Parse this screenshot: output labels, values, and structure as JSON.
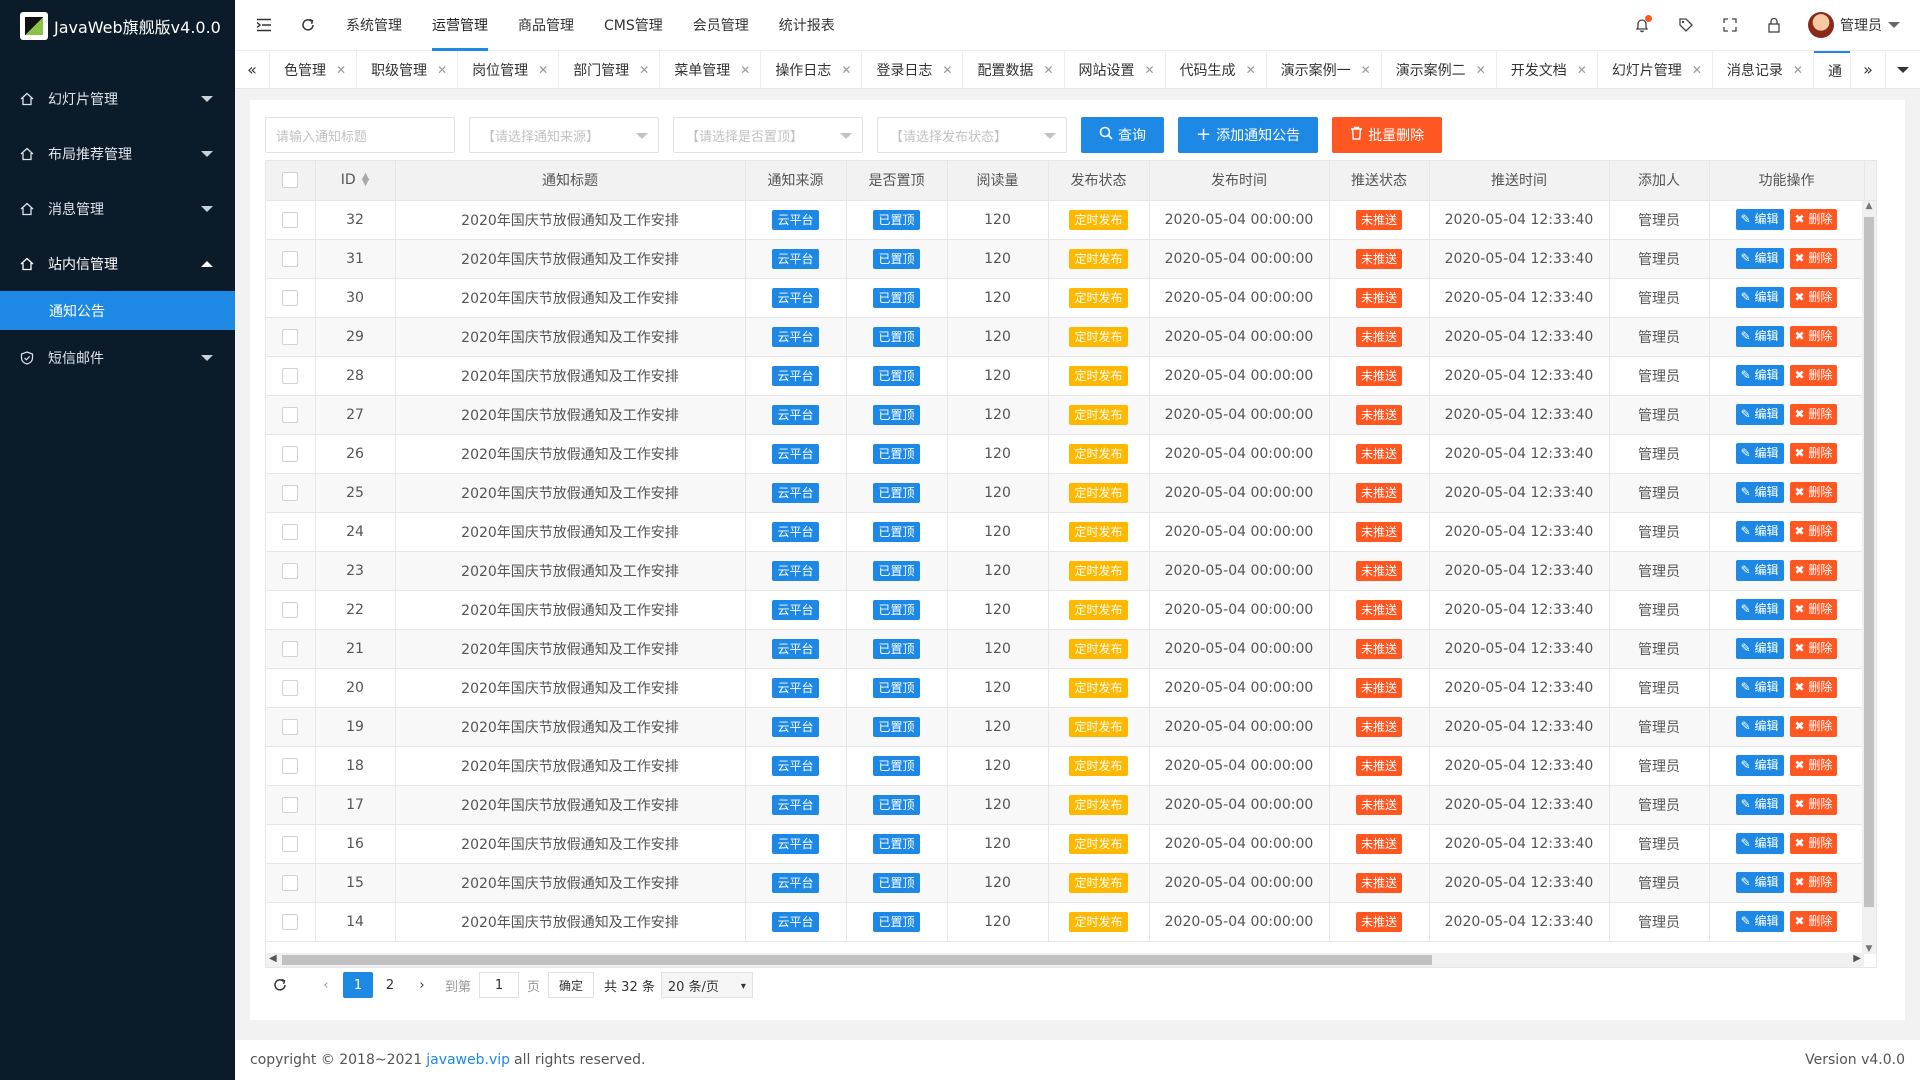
{
  "app": {
    "title": "JavaWeb旗舰版v4.0.0"
  },
  "sidebar": {
    "items": [
      {
        "label": "幻灯片管理"
      },
      {
        "label": "布局推荐管理"
      },
      {
        "label": "消息管理"
      },
      {
        "label": "站内信管理"
      },
      {
        "label": "通知公告"
      },
      {
        "label": "短信邮件"
      }
    ]
  },
  "header": {
    "nav": [
      "系统管理",
      "运营管理",
      "商品管理",
      "CMS管理",
      "会员管理",
      "统计报表"
    ],
    "active_nav": "运营管理",
    "user": "管理员"
  },
  "tabs": [
    "色管理",
    "职级管理",
    "岗位管理",
    "部门管理",
    "菜单管理",
    "操作日志",
    "登录日志",
    "配置数据",
    "网站设置",
    "代码生成",
    "演示案例一",
    "演示案例二",
    "开发文档",
    "幻灯片管理",
    "消息记录",
    "通"
  ],
  "filters": {
    "title_placeholder": "请输入通知标题",
    "source_placeholder": "【请选择通知来源】",
    "top_placeholder": "【请选择是否置顶】",
    "status_placeholder": "【请选择发布状态】",
    "query_label": "查询",
    "add_label": "添加通知公告",
    "batch_delete_label": "批量删除"
  },
  "table": {
    "columns": [
      "ID",
      "通知标题",
      "通知来源",
      "是否置顶",
      "阅读量",
      "发布状态",
      "发布时间",
      "推送状态",
      "推送时间",
      "添加人",
      "功能操作"
    ],
    "rows": [
      {
        "id": "32",
        "title": "2020年国庆节放假通知及工作安排",
        "source": "云平台",
        "top": "已置顶",
        "reads": "120",
        "status": "定时发布",
        "pub_time": "2020-05-04 00:00:00",
        "push": "未推送",
        "push_time": "2020-05-04 12:33:40",
        "adder": "管理员"
      },
      {
        "id": "31",
        "title": "2020年国庆节放假通知及工作安排",
        "source": "云平台",
        "top": "已置顶",
        "reads": "120",
        "status": "定时发布",
        "pub_time": "2020-05-04 00:00:00",
        "push": "未推送",
        "push_time": "2020-05-04 12:33:40",
        "adder": "管理员"
      },
      {
        "id": "30",
        "title": "2020年国庆节放假通知及工作安排",
        "source": "云平台",
        "top": "已置顶",
        "reads": "120",
        "status": "定时发布",
        "pub_time": "2020-05-04 00:00:00",
        "push": "未推送",
        "push_time": "2020-05-04 12:33:40",
        "adder": "管理员"
      },
      {
        "id": "29",
        "title": "2020年国庆节放假通知及工作安排",
        "source": "云平台",
        "top": "已置顶",
        "reads": "120",
        "status": "定时发布",
        "pub_time": "2020-05-04 00:00:00",
        "push": "未推送",
        "push_time": "2020-05-04 12:33:40",
        "adder": "管理员"
      },
      {
        "id": "28",
        "title": "2020年国庆节放假通知及工作安排",
        "source": "云平台",
        "top": "已置顶",
        "reads": "120",
        "status": "定时发布",
        "pub_time": "2020-05-04 00:00:00",
        "push": "未推送",
        "push_time": "2020-05-04 12:33:40",
        "adder": "管理员"
      },
      {
        "id": "27",
        "title": "2020年国庆节放假通知及工作安排",
        "source": "云平台",
        "top": "已置顶",
        "reads": "120",
        "status": "定时发布",
        "pub_time": "2020-05-04 00:00:00",
        "push": "未推送",
        "push_time": "2020-05-04 12:33:40",
        "adder": "管理员"
      },
      {
        "id": "26",
        "title": "2020年国庆节放假通知及工作安排",
        "source": "云平台",
        "top": "已置顶",
        "reads": "120",
        "status": "定时发布",
        "pub_time": "2020-05-04 00:00:00",
        "push": "未推送",
        "push_time": "2020-05-04 12:33:40",
        "adder": "管理员"
      },
      {
        "id": "25",
        "title": "2020年国庆节放假通知及工作安排",
        "source": "云平台",
        "top": "已置顶",
        "reads": "120",
        "status": "定时发布",
        "pub_time": "2020-05-04 00:00:00",
        "push": "未推送",
        "push_time": "2020-05-04 12:33:40",
        "adder": "管理员"
      },
      {
        "id": "24",
        "title": "2020年国庆节放假通知及工作安排",
        "source": "云平台",
        "top": "已置顶",
        "reads": "120",
        "status": "定时发布",
        "pub_time": "2020-05-04 00:00:00",
        "push": "未推送",
        "push_time": "2020-05-04 12:33:40",
        "adder": "管理员"
      },
      {
        "id": "23",
        "title": "2020年国庆节放假通知及工作安排",
        "source": "云平台",
        "top": "已置顶",
        "reads": "120",
        "status": "定时发布",
        "pub_time": "2020-05-04 00:00:00",
        "push": "未推送",
        "push_time": "2020-05-04 12:33:40",
        "adder": "管理员"
      },
      {
        "id": "22",
        "title": "2020年国庆节放假通知及工作安排",
        "source": "云平台",
        "top": "已置顶",
        "reads": "120",
        "status": "定时发布",
        "pub_time": "2020-05-04 00:00:00",
        "push": "未推送",
        "push_time": "2020-05-04 12:33:40",
        "adder": "管理员"
      },
      {
        "id": "21",
        "title": "2020年国庆节放假通知及工作安排",
        "source": "云平台",
        "top": "已置顶",
        "reads": "120",
        "status": "定时发布",
        "pub_time": "2020-05-04 00:00:00",
        "push": "未推送",
        "push_time": "2020-05-04 12:33:40",
        "adder": "管理员"
      },
      {
        "id": "20",
        "title": "2020年国庆节放假通知及工作安排",
        "source": "云平台",
        "top": "已置顶",
        "reads": "120",
        "status": "定时发布",
        "pub_time": "2020-05-04 00:00:00",
        "push": "未推送",
        "push_time": "2020-05-04 12:33:40",
        "adder": "管理员"
      },
      {
        "id": "19",
        "title": "2020年国庆节放假通知及工作安排",
        "source": "云平台",
        "top": "已置顶",
        "reads": "120",
        "status": "定时发布",
        "pub_time": "2020-05-04 00:00:00",
        "push": "未推送",
        "push_time": "2020-05-04 12:33:40",
        "adder": "管理员"
      },
      {
        "id": "18",
        "title": "2020年国庆节放假通知及工作安排",
        "source": "云平台",
        "top": "已置顶",
        "reads": "120",
        "status": "定时发布",
        "pub_time": "2020-05-04 00:00:00",
        "push": "未推送",
        "push_time": "2020-05-04 12:33:40",
        "adder": "管理员"
      },
      {
        "id": "17",
        "title": "2020年国庆节放假通知及工作安排",
        "source": "云平台",
        "top": "已置顶",
        "reads": "120",
        "status": "定时发布",
        "pub_time": "2020-05-04 00:00:00",
        "push": "未推送",
        "push_time": "2020-05-04 12:33:40",
        "adder": "管理员"
      },
      {
        "id": "16",
        "title": "2020年国庆节放假通知及工作安排",
        "source": "云平台",
        "top": "已置顶",
        "reads": "120",
        "status": "定时发布",
        "pub_time": "2020-05-04 00:00:00",
        "push": "未推送",
        "push_time": "2020-05-04 12:33:40",
        "adder": "管理员"
      },
      {
        "id": "15",
        "title": "2020年国庆节放假通知及工作安排",
        "source": "云平台",
        "top": "已置顶",
        "reads": "120",
        "status": "定时发布",
        "pub_time": "2020-05-04 00:00:00",
        "push": "未推送",
        "push_time": "2020-05-04 12:33:40",
        "adder": "管理员"
      },
      {
        "id": "14",
        "title": "2020年国庆节放假通知及工作安排",
        "source": "云平台",
        "top": "已置顶",
        "reads": "120",
        "status": "定时发布",
        "pub_time": "2020-05-04 00:00:00",
        "push": "未推送",
        "push_time": "2020-05-04 12:33:40",
        "adder": "管理员"
      }
    ],
    "edit_label": "编辑",
    "delete_label": "删除"
  },
  "pagination": {
    "pages": [
      "1",
      "2"
    ],
    "current": "1",
    "goto_label": "到第",
    "goto_value": "1",
    "page_unit": "页",
    "confirm_label": "确定",
    "total_label": "共 32 条",
    "page_size": "20 条/页"
  },
  "footer": {
    "copyright": "copyright © 2018~2021",
    "link": "javaweb.vip",
    "rights": "all rights reserved.",
    "version": "Version v4.0.0"
  },
  "colors": {
    "primary": "#1e88e5",
    "danger": "#ff5722",
    "warn": "#ffb800",
    "sidebar": "#0c1b2a"
  }
}
